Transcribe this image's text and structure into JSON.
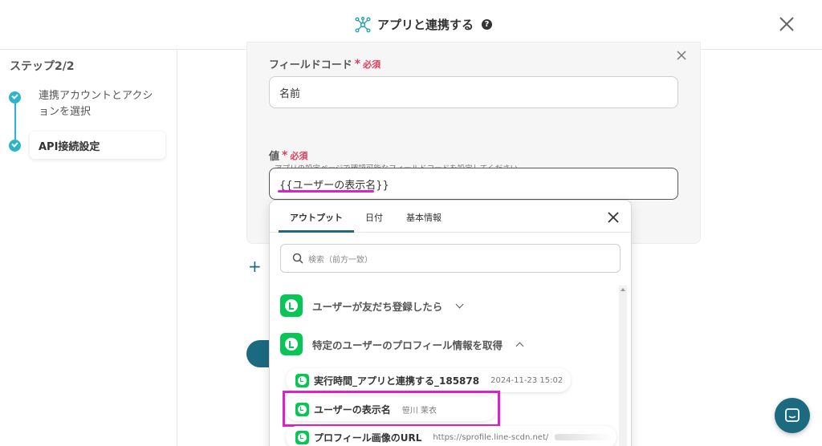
{
  "header": {
    "title": "アプリと連携する",
    "help_glyph": "?"
  },
  "sidebar": {
    "step_title": "ステップ2/2",
    "steps": [
      {
        "label": "連携アカウントとアクションを選択",
        "done": true
      },
      {
        "label": "API接続設定",
        "done": true,
        "current": true
      }
    ]
  },
  "form": {
    "field_code_label": "フィールドコード",
    "required_mark": "*",
    "required_text": "必須",
    "field_code_value": "名前",
    "field_code_help": "アプリの設定ページで確認可能なフィールドコードを設定してください。",
    "value_label": "値",
    "value_value": "{{ユーザーの表示名}}"
  },
  "dropdown": {
    "tabs": [
      {
        "label": "アウトプット",
        "active": true
      },
      {
        "label": "日付",
        "active": false
      },
      {
        "label": "基本情報",
        "active": false
      }
    ],
    "search_placeholder": "検索（前方一致）",
    "apps": [
      {
        "label": "ユーザーが友だち登録したら",
        "expanded": false
      },
      {
        "label": "特定のユーザーのプロフィール情報を取得",
        "expanded": true
      }
    ],
    "outputs": [
      {
        "name": "実行時間_アプリと連携する_185878",
        "value": "2024-11-23 15:02"
      },
      {
        "name": "ユーザーの表示名",
        "value": "笹川 茉衣"
      },
      {
        "name": "プロフィール画像のURL",
        "value": "https://sprofile.line-scdn.net/"
      }
    ]
  },
  "colors": {
    "accent": "#1b6a80",
    "step_check": "#2cb5c9",
    "required": "#e03c5a",
    "highlight": "#e11ec8",
    "line_green": "#06c755"
  }
}
